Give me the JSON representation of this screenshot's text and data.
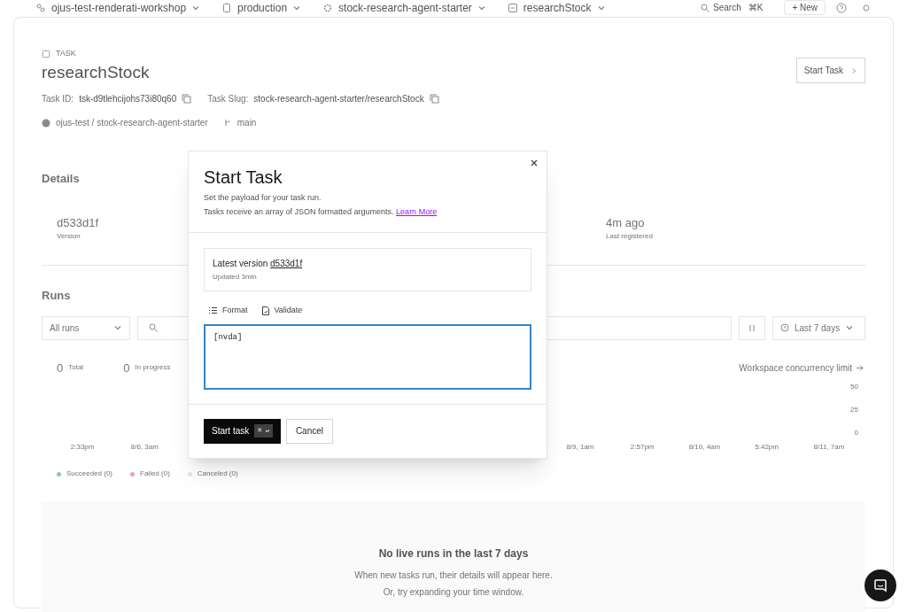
{
  "breadcrumbs": [
    {
      "kind": "org",
      "label": "ojus-test-renderati-workshop"
    },
    {
      "kind": "env",
      "label": "production"
    },
    {
      "kind": "project",
      "label": "stock-research-agent-starter"
    },
    {
      "kind": "task",
      "label": "researchStock"
    }
  ],
  "top_actions": {
    "search": "Search",
    "search_shortcut": "⌘K",
    "new": "+ New"
  },
  "task": {
    "eyebrow": "TASK",
    "title": "researchStock",
    "start_button": "Start Task",
    "id_label": "Task ID:",
    "id": "tsk-d9tlehcijohs73i80q60",
    "slug_label": "Task Slug:",
    "slug": "stock-research-agent-starter/researchStock",
    "repo": "ojus-test / stock-research-agent-starter",
    "branch": "main"
  },
  "details": {
    "heading": "Details",
    "items": [
      {
        "value": "d533d1f",
        "label": "Version"
      },
      {
        "value": "4m ago",
        "label": "Last registered"
      }
    ]
  },
  "runs": {
    "heading": "Runs",
    "filter": "All runs",
    "period": "Last 7 days",
    "stats": [
      {
        "value": "0",
        "label": "Total"
      },
      {
        "value": "0",
        "label": "In progress"
      }
    ],
    "concurrency_link": "Workspace concurrency limit",
    "y_ticks": [
      "50",
      "25",
      "0"
    ],
    "x_labels_left": [
      "2:33pm",
      "8/6, 3am"
    ],
    "x_labels_right": [
      "8/9, 1am",
      "2:57pm",
      "8/10, 4am",
      "5:42pm",
      "8/11, 7am"
    ],
    "legend": [
      {
        "label": "Succeeded (0)",
        "color": "#86c9a0"
      },
      {
        "label": "Failed (0)",
        "color": "#f0a0a8"
      },
      {
        "label": "Canceled (0)",
        "color": "#e5e5e5"
      }
    ],
    "empty_title": "No live runs in the last 7 days",
    "empty_lines": [
      "When new tasks run, their details will appear here.",
      "Or, try expanding your time window."
    ]
  },
  "dialog": {
    "title": "Start Task",
    "subtitle": "Set the payload for your task run.",
    "description": "Tasks receive an array of JSON formatted arguments.",
    "link": "Learn More",
    "version_label": "Latest version",
    "version": "d533d1f",
    "updated": "Updated 3min",
    "tools": [
      {
        "kind": "format",
        "label": "Format"
      },
      {
        "kind": "validate",
        "label": "Validate"
      }
    ],
    "payload": "[nvda]",
    "submit": "Start task",
    "submit_shortcut": "⌘ ↵",
    "cancel": "Cancel"
  }
}
